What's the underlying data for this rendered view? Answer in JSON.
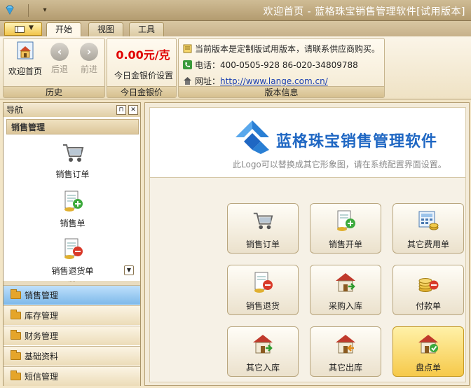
{
  "window": {
    "title": "欢迎首页 - 蓝格珠宝销售管理软件[试用版本]"
  },
  "tabs": [
    {
      "label": "开始",
      "active": true
    },
    {
      "label": "视图",
      "active": false
    },
    {
      "label": "工具",
      "active": false
    }
  ],
  "ribbon": {
    "history": {
      "label": "历史",
      "home": "欢迎首页",
      "back": "后退",
      "forward": "前进"
    },
    "gold": {
      "label": "今日金银价",
      "price": "0.00元/克",
      "setting": "今日金银价设置"
    },
    "info": {
      "label": "版本信息",
      "notice": "当前版本是定制版试用版本，请联系供应商购买。",
      "phone_label": "电话：",
      "phone": "400-0505-928  86-020-34809788",
      "site_label": "网址：",
      "site": "http://www.lange.com.cn/"
    }
  },
  "nav": {
    "title": "导航",
    "section": "销售管理",
    "items": [
      {
        "label": "销售订单",
        "icon": "cart-icon"
      },
      {
        "label": "销售单",
        "icon": "doc-add-icon"
      },
      {
        "label": "销售退货单",
        "icon": "doc-remove-icon"
      }
    ],
    "categories": [
      {
        "label": "销售管理",
        "active": true
      },
      {
        "label": "库存管理",
        "active": false
      },
      {
        "label": "财务管理",
        "active": false
      },
      {
        "label": "基础资料",
        "active": false
      },
      {
        "label": "短信管理",
        "active": false
      }
    ]
  },
  "main": {
    "logo_title": "蓝格珠宝销售管理软件",
    "logo_note": "此Logo可以替换成其它形象图，请在系统配置界面设置。",
    "tiles": [
      {
        "label": "销售订单",
        "icon": "cart-icon"
      },
      {
        "label": "销售开单",
        "icon": "doc-add-icon"
      },
      {
        "label": "其它费用单",
        "icon": "calculator-icon"
      },
      {
        "label": "销售退货",
        "icon": "doc-remove-icon"
      },
      {
        "label": "采购入库",
        "icon": "house-in-icon"
      },
      {
        "label": "付款单",
        "icon": "coins-icon"
      },
      {
        "label": "其它入库",
        "icon": "house-in-icon"
      },
      {
        "label": "其它出库",
        "icon": "house-out-icon"
      },
      {
        "label": "盘点单",
        "icon": "house-check-icon",
        "active": true
      }
    ]
  }
}
